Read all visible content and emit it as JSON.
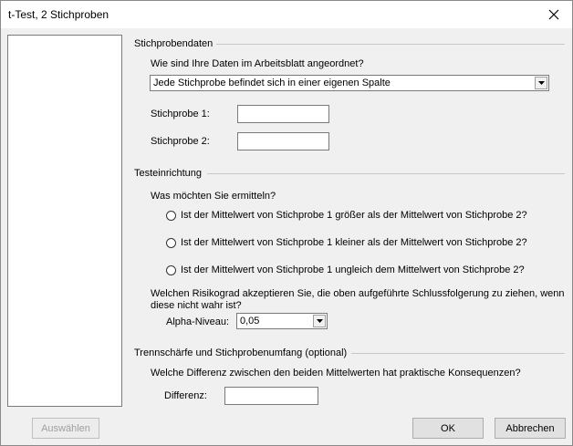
{
  "window": {
    "title": "t-Test, 2 Stichproben"
  },
  "sections": {
    "sample_data": {
      "heading": "Stichprobendaten",
      "question": "Wie sind Ihre Daten im Arbeitsblatt angeordnet?",
      "arrangement_value": "Jede Stichprobe befindet sich in einer eigenen Spalte",
      "sample1_label": "Stichprobe 1:",
      "sample1_value": "",
      "sample2_label": "Stichprobe 2:",
      "sample2_value": ""
    },
    "test_setup": {
      "heading": "Testeinrichtung",
      "question": "Was möchten Sie ermitteln?",
      "options": [
        "Ist der Mittelwert von Stichprobe 1 größer als der Mittelwert von Stichprobe 2?",
        "Ist der Mittelwert von Stichprobe 1 kleiner als der Mittelwert von Stichprobe 2?",
        "Ist der Mittelwert von Stichprobe 1 ungleich dem Mittelwert von Stichprobe 2?"
      ],
      "risk_line1": "Welchen Risikograd akzeptieren Sie, die oben aufgeführte Schlussfolgerung zu ziehen, wenn",
      "risk_line2": "diese nicht wahr ist?",
      "alpha_label": "Alpha-Niveau:",
      "alpha_value": "0,05"
    },
    "power": {
      "heading": "Trennschärfe und Stichprobenumfang (optional)",
      "question": "Welche Differenz zwischen den beiden Mittelwerten hat praktische Konsequenzen?",
      "difference_label": "Differenz:",
      "difference_value": ""
    }
  },
  "buttons": {
    "select": "Auswählen",
    "ok": "OK",
    "cancel": "Abbrechen"
  },
  "icons": {
    "close": "close-icon",
    "dropdown": "chevron-down-icon"
  }
}
